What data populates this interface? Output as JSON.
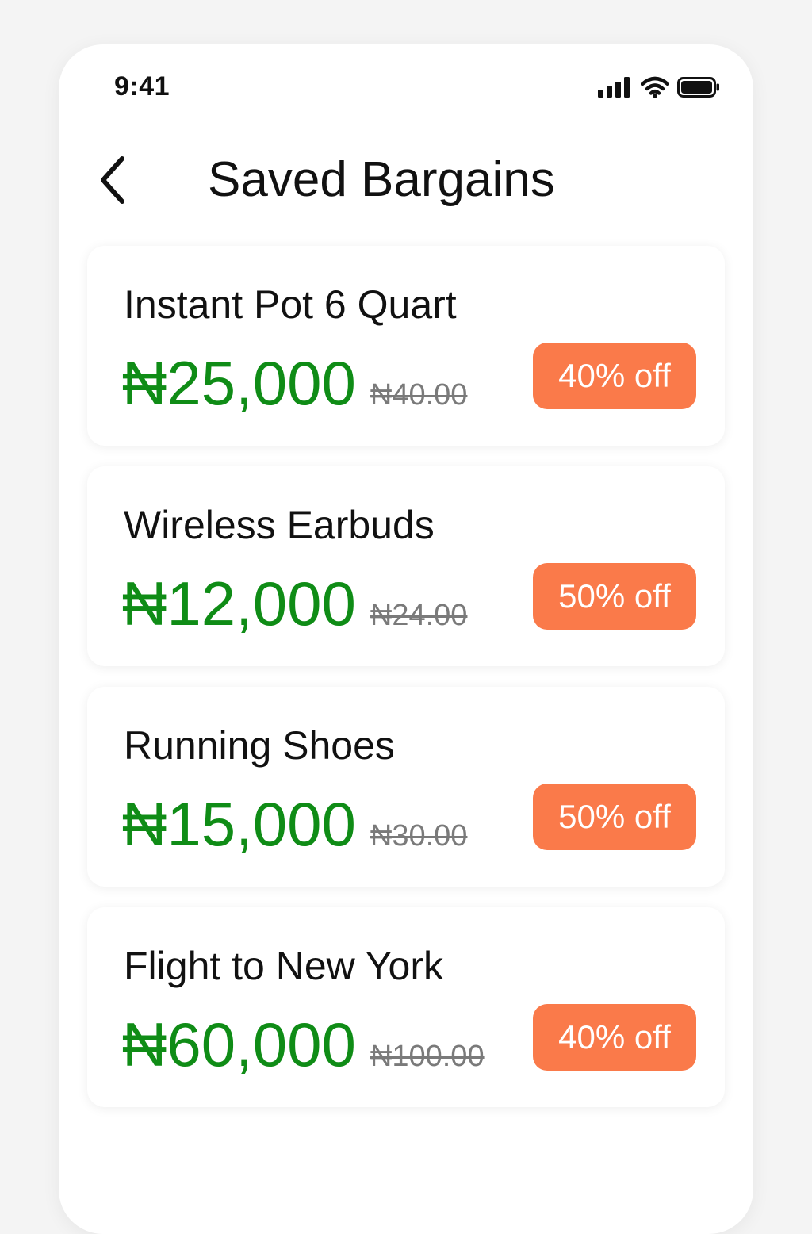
{
  "status_bar": {
    "time": "9:41",
    "icons": [
      "signal-icon",
      "wifi-icon",
      "battery-icon"
    ]
  },
  "header": {
    "back_icon": "chevron-left-icon",
    "title": "Saved Bargains"
  },
  "colors": {
    "price_green": "#0f8c16",
    "badge_orange": "#fa7a4a",
    "old_price_gray": "#7a7a7a"
  },
  "items": [
    {
      "name": "Instant Pot 6 Quart",
      "price": "₦25,000",
      "old_price": "₦40.00",
      "discount": "40% off"
    },
    {
      "name": "Wireless Earbuds",
      "price": "₦12,000",
      "old_price": "₦24.00",
      "discount": "50% off"
    },
    {
      "name": "Running Shoes",
      "price": "₦15,000",
      "old_price": "₦30.00",
      "discount": "50% off"
    },
    {
      "name": "Flight to New York",
      "price": "₦60,000",
      "old_price": "₦100.00",
      "discount": "40% off"
    }
  ]
}
